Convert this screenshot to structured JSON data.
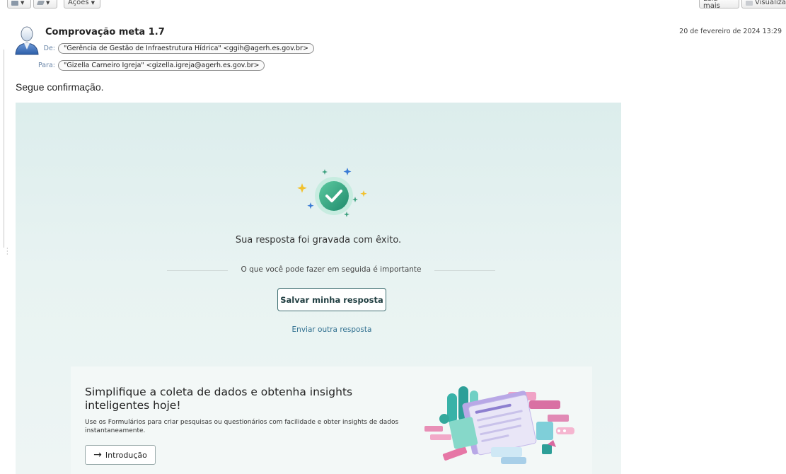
{
  "toolbar": {
    "actions_label": "Ações",
    "read_more_label": "Leia mais",
    "view_label": "Visualiza"
  },
  "email": {
    "subject": "Comprovação meta 1.7",
    "date": "20 de fevereiro de 2024 13:29",
    "from_label": "De:",
    "from": "\"Gerência de Gestão de Infraestrutura Hídrica\" <ggih@agerh.es.gov.br>",
    "to_label": "Para:",
    "to": "\"Gizella Carneiro Igreja\" <gizella.igreja@agerh.es.gov.br>",
    "body": "Segue confirmação."
  },
  "form": {
    "success_message": "Sua resposta foi gravada com êxito.",
    "next_heading": "O que você pode fazer em seguida é importante",
    "save_button": "Salvar minha resposta",
    "send_another": "Enviar outra resposta",
    "promo": {
      "title": "Simplifique a coleta de dados e obtenha insights inteligentes hoje!",
      "description": "Use os Formulários para criar pesquisas ou questionários com facilidade e obter insights de dados instantaneamente.",
      "intro_button": "Introdução"
    }
  },
  "colors": {
    "card_bg": "#dcedec",
    "accent": "#3f6f72",
    "link": "#2f6f8f",
    "check_green": "#2f9e7a"
  },
  "icons": {
    "avatar": "user-avatar-icon",
    "check": "success-check-icon",
    "arrow": "arrow-right-icon"
  }
}
